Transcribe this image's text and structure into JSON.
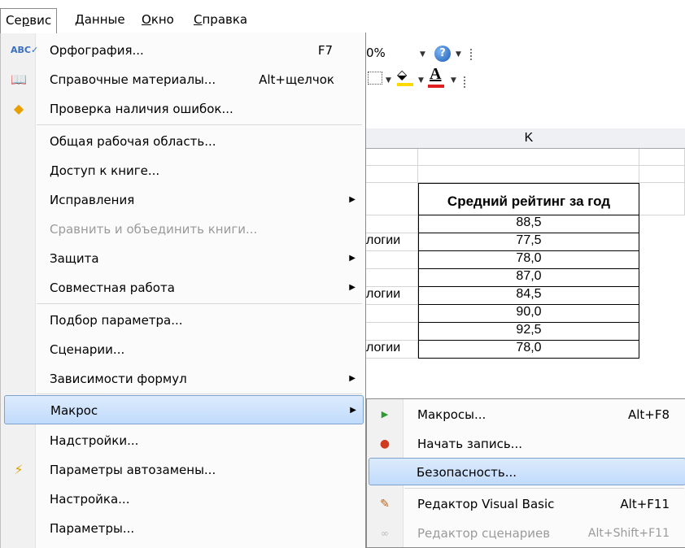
{
  "menubar": {
    "items": [
      {
        "label": "Сервис",
        "open": true
      },
      {
        "label": "Данные"
      },
      {
        "label": "Окно"
      },
      {
        "label": "Справка"
      }
    ]
  },
  "toolbar": {
    "zoom_value": "0%",
    "help_icon": "help-icon"
  },
  "sheet": {
    "column_header": "K",
    "k_header": "Средний рейтинг за год",
    "j_values": [
      "",
      "логии",
      "",
      "",
      "логии",
      "",
      "",
      "логии"
    ],
    "k_values": [
      "88,5",
      "77,5",
      "78,0",
      "87,0",
      "84,5",
      "90,0",
      "92,5",
      "78,0"
    ]
  },
  "main_menu": {
    "items": [
      {
        "label": "Орфография...",
        "shortcut": "F7",
        "icon": "spellcheck-icon"
      },
      {
        "label": "Справочные материалы...",
        "shortcut": "Alt+щелчок",
        "icon": "research-icon"
      },
      {
        "label": "Проверка наличия ошибок...",
        "icon": "error-check-icon"
      },
      {
        "label": "Общая рабочая область..."
      },
      {
        "label": "Доступ к книге..."
      },
      {
        "label": "Исправления",
        "submenu": true
      },
      {
        "label": "Сравнить и объединить книги...",
        "disabled": true
      },
      {
        "label": "Защита",
        "submenu": true
      },
      {
        "label": "Совместная работа",
        "submenu": true
      },
      {
        "label": "Подбор параметра..."
      },
      {
        "label": "Сценарии..."
      },
      {
        "label": "Зависимости формул",
        "submenu": true
      },
      {
        "label": "Макрос",
        "submenu": true,
        "highlighted": true
      },
      {
        "label": "Надстройки..."
      },
      {
        "label": "Параметры автозамены...",
        "icon": "autocorrect-icon"
      },
      {
        "label": "Настройка..."
      },
      {
        "label": "Параметры..."
      }
    ]
  },
  "macro_submenu": {
    "items": [
      {
        "label": "Макросы...",
        "shortcut": "Alt+F8",
        "icon": "run-macro-icon"
      },
      {
        "label": "Начать запись...",
        "icon": "record-icon"
      },
      {
        "label": "Безопасность...",
        "highlighted": true
      },
      {
        "label": "Редактор Visual Basic",
        "shortcut": "Alt+F11",
        "icon": "vb-editor-icon"
      },
      {
        "label": "Редактор сценариев",
        "shortcut": "Alt+Shift+F11",
        "icon": "script-editor-icon",
        "disabled": true
      }
    ]
  },
  "colors": {
    "highlight": "#c1dbfc",
    "highlight_border": "#7da2ce",
    "fill_color": "#ffd800",
    "font_color": "#e02020"
  }
}
